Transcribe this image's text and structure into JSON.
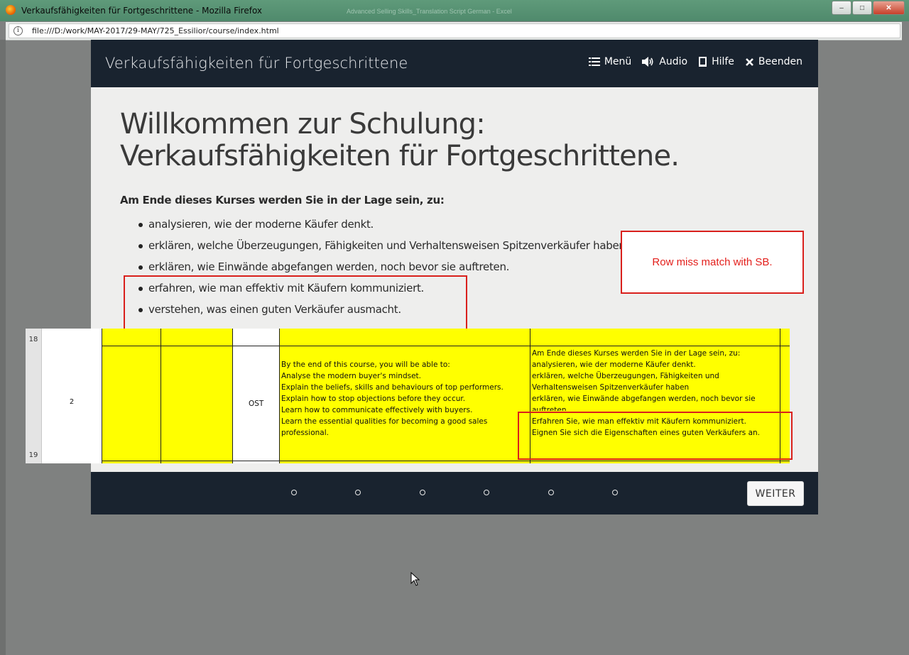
{
  "window": {
    "title": "Verkaufsfähigkeiten für Fortgeschrittene - Mozilla Firefox",
    "faint_title": "Advanced Selling Skills_Translation Script German - Excel",
    "controls": {
      "minimize": "–",
      "maximize": "□",
      "close": "✕"
    }
  },
  "browser": {
    "info_icon": "i",
    "url": "file:///D:/work/MAY-2017/29-MAY/725_Essilior/course/index.html"
  },
  "course": {
    "title": "Verkaufsfähigkeiten für Fortgeschrittene",
    "nav": [
      {
        "icon": "menu-list-icon",
        "label": "Menü"
      },
      {
        "icon": "speaker-icon",
        "label": "Audio"
      },
      {
        "icon": "book-icon",
        "label": "Hilfe"
      },
      {
        "icon": "close-x-icon",
        "label": "Beenden"
      }
    ],
    "heading": "Willkommen zur Schulung: Verkaufsfähigkeiten für Fortgeschrittene.",
    "lead": "Am Ende dieses Kurses werden Sie in der Lage sein, zu:",
    "objectives": [
      "analysieren, wie der moderne Käufer denkt.",
      "erklären, welche Überzeugungen, Fähigkeiten und Verhaltensweisen Spitzenverkäufer haben.",
      "erklären, wie Einwände abgefangen werden, noch bevor sie auftreten.",
      "erfahren, wie man effektiv mit Käufern kommuniziert.",
      "verstehen, was einen guten Verkäufer ausmacht."
    ],
    "next_button": "WEITER",
    "progress_dots": 6
  },
  "review_note": "Row miss match with SB.",
  "spreadsheet": {
    "row_numbers": [
      "18",
      "19"
    ],
    "screen_number": "2",
    "type": "OST",
    "english_lines": [
      "By the end of this course, you will be able to:",
      "Analyse the modern buyer's mindset.",
      "Explain the beliefs, skills and behaviours of top performers.",
      "Explain how to stop objections before they occur.",
      "Learn how to communicate effectively with buyers.",
      "Learn the essential qualities for becoming a good sales",
      "professional."
    ],
    "german_lines": [
      "Am Ende dieses Kurses werden Sie in der Lage sein, zu:",
      "analysieren, wie der moderne Käufer denkt.",
      "erklären, welche Überzeugungen, Fähigkeiten und",
      "Verhaltensweisen Spitzenverkäufer haben",
      "erklären, wie Einwände abgefangen werden, noch bevor sie",
      "auftreten.",
      "Erfahren Sie, wie man effektiv mit Käufern kommuniziert.",
      "Eignen Sie sich die Eigenschaften eines guten Verkäufers an."
    ]
  }
}
